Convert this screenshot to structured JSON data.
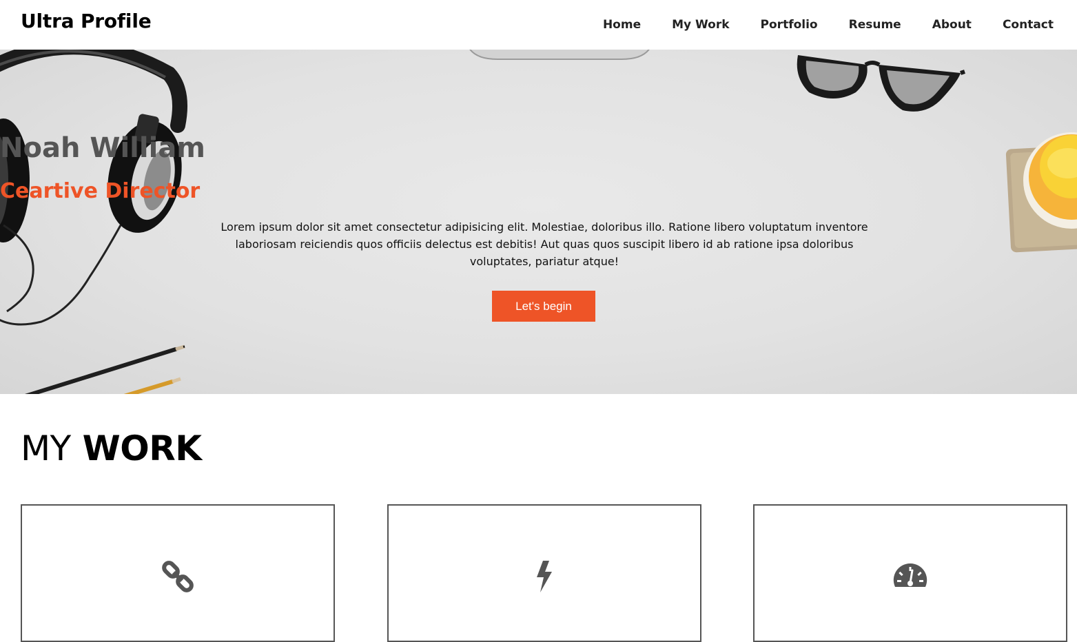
{
  "brand": "Ultra Profile",
  "nav": {
    "items": [
      {
        "label": "Home"
      },
      {
        "label": "My Work"
      },
      {
        "label": "Portfolio"
      },
      {
        "label": "Resume"
      },
      {
        "label": "About"
      },
      {
        "label": "Contact"
      }
    ]
  },
  "hero": {
    "name": "Noah William",
    "role": "Ceartive Director",
    "text": "Lorem ipsum dolor sit amet consectetur adipisicing elit. Molestiae, doloribus illo. Ratione libero voluptatum inventore laboriosam reiciendis quos officiis delectus est debitis! Aut quas quos suscipit libero id ab ratione ipsa doloribus voluptates, pariatur atque!",
    "button_label": "Let's begin"
  },
  "my_work": {
    "title_light": "MY",
    "title_bold": "WORK",
    "cards": [
      {
        "icon": "link-icon"
      },
      {
        "icon": "bolt-icon"
      },
      {
        "icon": "speedometer-icon"
      }
    ]
  },
  "colors": {
    "accent": "#ee5427",
    "hero_name": "#555555",
    "card_border": "#555555",
    "icon": "#555555"
  }
}
